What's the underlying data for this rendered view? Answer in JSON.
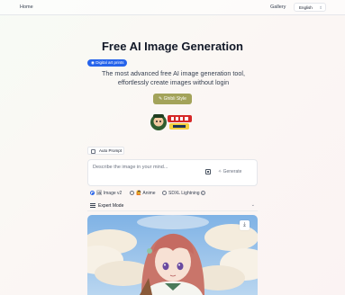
{
  "nav": {
    "home": "Home",
    "gallery": "Gallery",
    "language": "English"
  },
  "hero": {
    "title": "Free AI Image Generation",
    "tag": "Digital art prints",
    "subtitle": "The most advanced free AI image generation tool, effortlessly create images without login",
    "style_button": "Ghibli Style"
  },
  "generator": {
    "auto_prompt": "Auto Prompt",
    "auto_prompt_checked": false,
    "prompt_placeholder": "Describe the image in your mind...",
    "generate": "Generate",
    "models": [
      {
        "label": "Image v2",
        "selected": true,
        "emoji": "🖼"
      },
      {
        "label": "Anime",
        "selected": false,
        "emoji": "🙋"
      },
      {
        "label": "SDXL Lightning",
        "selected": false,
        "has_info": true
      }
    ],
    "expert_mode": "Expert Mode"
  },
  "icons": {
    "tag": "circle-icon",
    "style": "palette-icon",
    "upload": "image-upload-icon",
    "generate": "sparkle-icon",
    "expert": "sliders-icon",
    "expert_toggle": "chevron-down-icon",
    "download": "download-icon",
    "language": "chevron-updown-icon"
  },
  "colors": {
    "accent_blue": "#2563eb",
    "style_button": "#a3a35a"
  }
}
